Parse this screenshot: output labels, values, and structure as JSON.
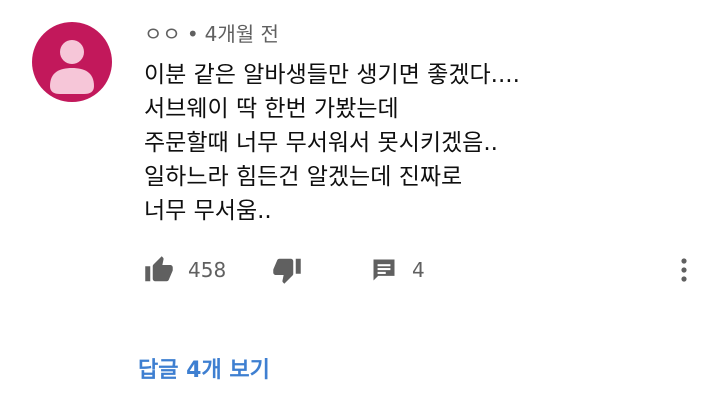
{
  "comment": {
    "author": "ㅇㅇ",
    "separator": "•",
    "time_ago": "4개월 전",
    "avatar_color": "#c2185b",
    "avatar_icon": "person-icon",
    "text_lines": [
      "이분 같은 알바생들만 생기면 좋겠다....",
      "서브웨이 딱 한번 가봤는데",
      "주문할때 너무 무서워서 못시키겠음..",
      "일하느라 힘든건 알겠는데 진짜로",
      "너무 무서움.."
    ],
    "likes": "458",
    "replies_count": "4",
    "view_replies_label": "답글 4개 보기",
    "link_color": "#3e7fd1",
    "icons": {
      "like": "thumbs-up-icon",
      "dislike": "thumbs-down-icon",
      "reply": "comment-icon",
      "more": "more-vertical-icon"
    }
  }
}
